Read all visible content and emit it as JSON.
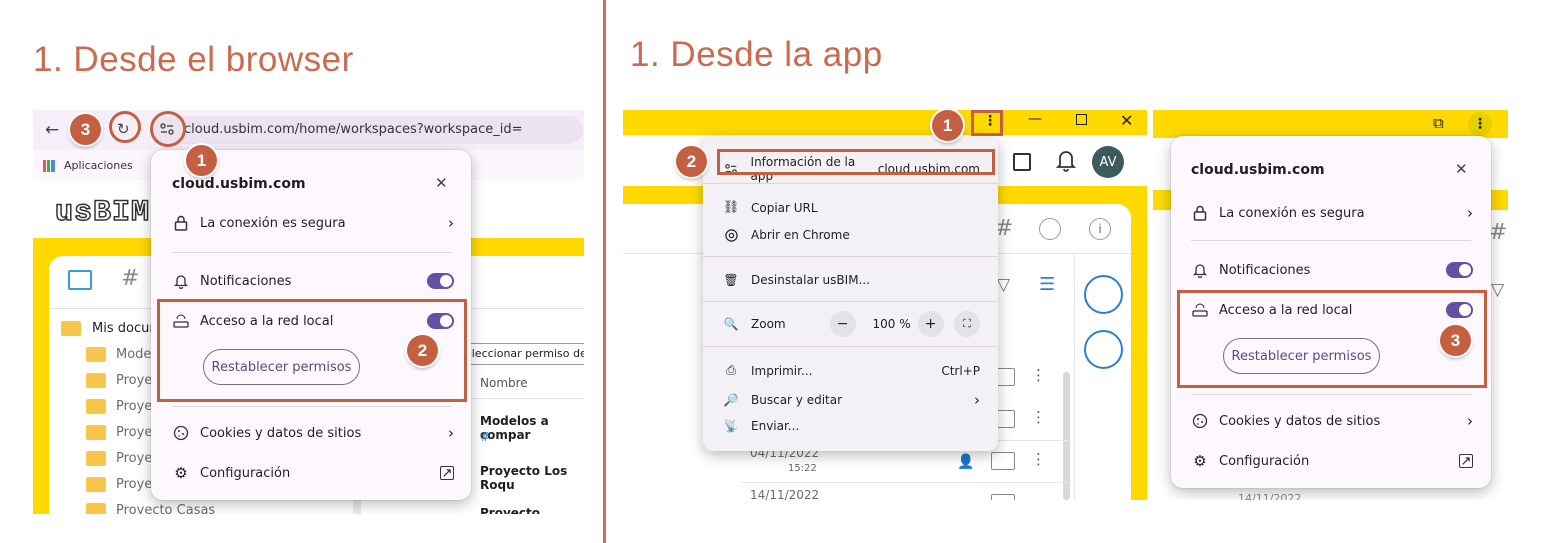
{
  "left": {
    "heading": "1. Desde el browser",
    "url": "cloud.usbim.com/home/workspaces?workspace_id=",
    "bookmarks_label": "Aplicaciones",
    "logo": "usBIM",
    "popup": {
      "site": "cloud.usbim.com",
      "secure": "La conexión es segura",
      "notifications": "Notificaciones",
      "local_network": "Acceso a la red local",
      "reset": "Restablecer permisos",
      "cookies": "Cookies y datos de sitios",
      "settings": "Configuración"
    },
    "tooltip": "Seleccionar permiso de a",
    "sidebar_root": "Mis docum",
    "sidebar_items": [
      "Mode",
      "Proye",
      "Proye",
      "Proye",
      "Proye",
      "Proye",
      "Proyecto Casas"
    ],
    "col_header": "Nombre",
    "rows": [
      "Modelos a compar",
      "Proyecto Los Roqu",
      "Proyecto Centro d"
    ],
    "row_hash": "#",
    "badges": {
      "b1": "1",
      "b2": "2",
      "b3": "3"
    }
  },
  "right": {
    "heading": "1. Desde la app",
    "menu": {
      "app_info": "Información de la app",
      "app_domain": "cloud.usbim.com",
      "copy_url": "Copiar URL",
      "open_chrome": "Abrir en Chrome",
      "uninstall": "Desinstalar usBIM...",
      "zoom": "Zoom",
      "zoom_value": "100 %",
      "zoom_minus": "−",
      "zoom_plus": "+",
      "print": "Imprimir...",
      "print_shortcut": "Ctrl+P",
      "find": "Buscar y editar",
      "send": "Enviar..."
    },
    "avatar": "AV",
    "dates": [
      {
        "date": "04/11/2022",
        "time": "15:22"
      },
      {
        "date": "14/11/2022",
        "time": ""
      }
    ],
    "popup": {
      "site": "cloud.usbim.com",
      "secure": "La conexión es segura",
      "notifications": "Notificaciones",
      "local_network": "Acceso a la red local",
      "reset": "Restablecer permisos",
      "cookies": "Cookies y datos de sitios",
      "settings": "Configuración",
      "date_peek": "14/11/2022"
    },
    "badges": {
      "b1": "1",
      "b2": "2",
      "b3": "3"
    }
  },
  "colors": {
    "accent": "#c45f42",
    "yellow": "#ffd900",
    "toggle": "#6650a4"
  }
}
